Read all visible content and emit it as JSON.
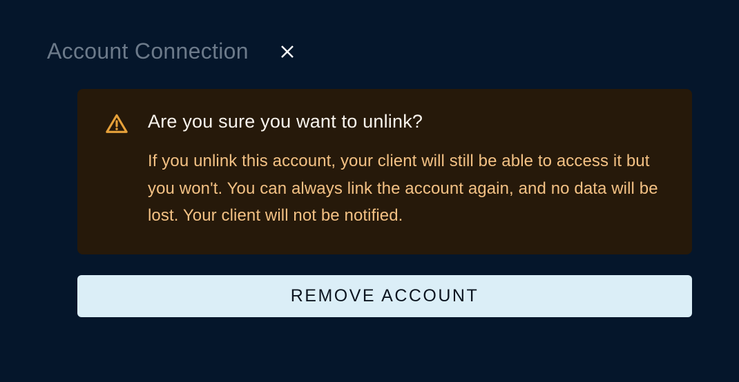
{
  "dialog": {
    "title": "Account Connection",
    "warning": {
      "heading": "Are you sure you want to unlink?",
      "body": "If you unlink this account, your client will still be able to access it but you won't. You can always link the account again, and no data will be lost. Your client will not be notified."
    },
    "action_label": "REMOVE ACCOUNT"
  },
  "colors": {
    "background": "#05162b",
    "card_background": "#26190a",
    "title_text": "#6c7a8a",
    "warning_heading": "#f9f4ed",
    "warning_body": "#f3c184",
    "warning_icon": "#e6a13a",
    "button_background": "#dbeef7",
    "button_text": "#0c1520",
    "close_icon": "#ffffff"
  },
  "icons": {
    "warning": "warning-triangle-icon",
    "close": "close-icon"
  }
}
